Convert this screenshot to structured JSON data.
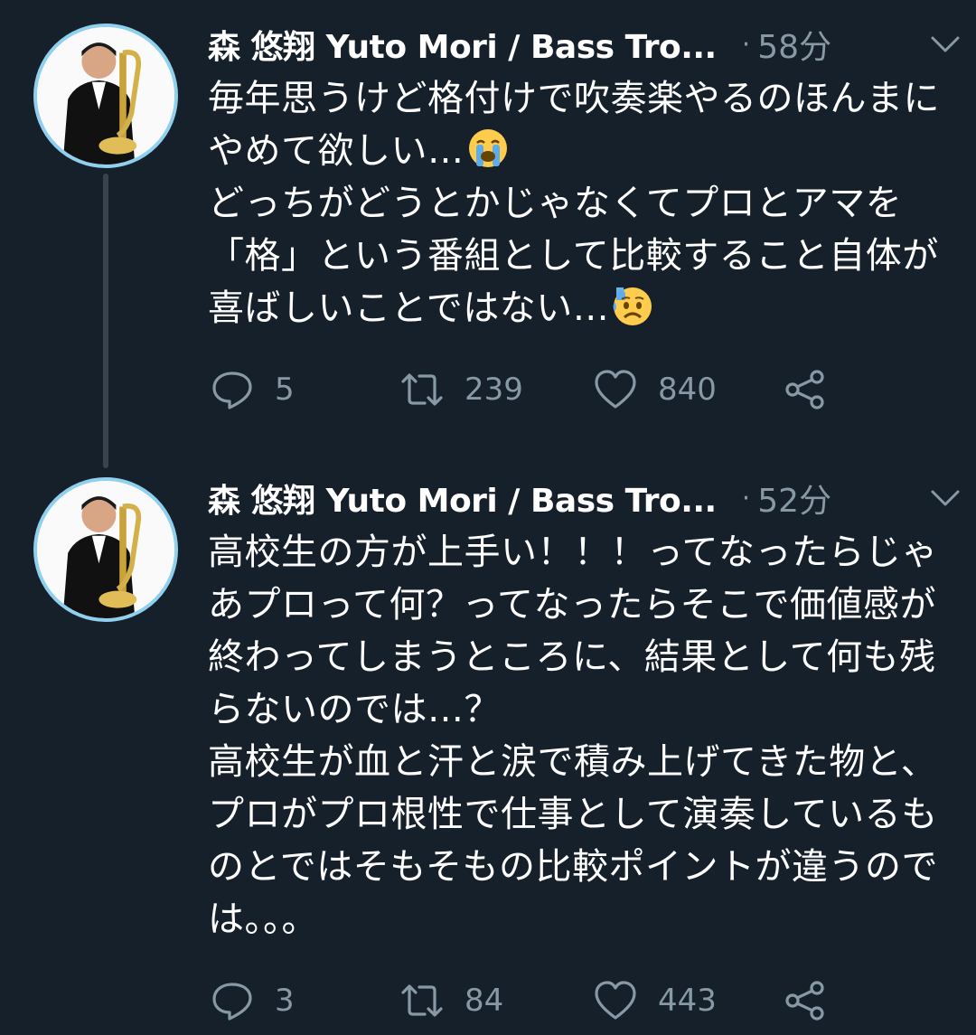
{
  "colors": {
    "background": "#15202b",
    "text": "#ffffff",
    "secondary_text": "#8899a6",
    "thread_line": "#38444d",
    "avatar_ring": "#8fd0ee"
  },
  "tweets": [
    {
      "display_name": "森 悠翔 Yuto Mori / Bass Tro...",
      "separator": "·",
      "time": "58分",
      "text_before_emoji_1": "毎年思うけど格付けで吹奏楽やるのほんまにやめて欲しい…",
      "text_before_emoji_2": "\nどっちがどうとかじゃなくてプロとアマを「格」という番組として比較すること自体が喜ばしいことではない…",
      "emoji_1": "loudly-crying-face-icon",
      "emoji_2": "anxious-face-with-sweat-icon",
      "reply_count": "5",
      "retweet_count": "239",
      "like_count": "840"
    },
    {
      "display_name": "森 悠翔 Yuto Mori / Bass Tro...",
      "separator": "·",
      "time": "52分",
      "text": "高校生の方が上手い！！！ってなったらじゃあプロって何？ってなったらそこで価値感が終わってしまうところに、結果として何も残らないのでは…？\n高校生が血と汗と涙で積み上げてきた物と、プロがプロ根性で仕事として演奏しているものとではそもそもの比較ポイントが違うのでは。。。",
      "reply_count": "3",
      "retweet_count": "84",
      "like_count": "443"
    }
  ]
}
